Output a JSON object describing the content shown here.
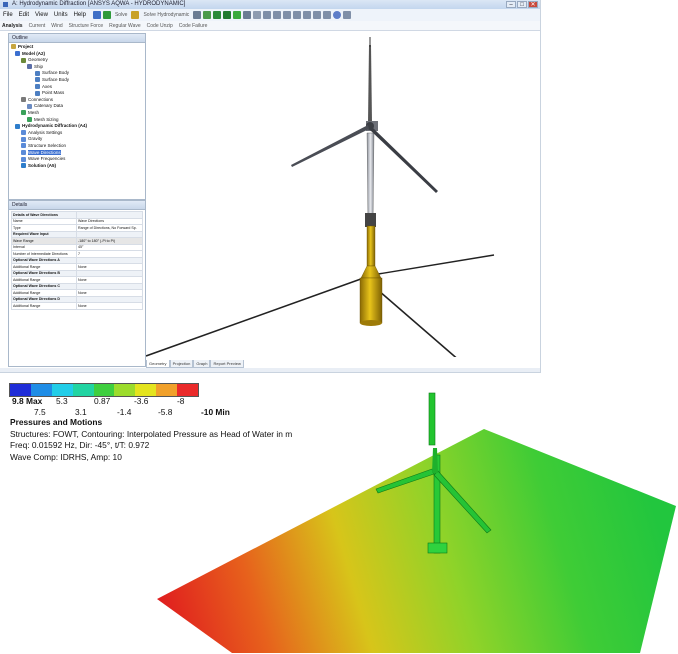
{
  "window": {
    "title": "A: Hydrodynamic Diffraction [ANSYS AQWA - HYDRODYNAMIC]",
    "controls": [
      "–",
      "□",
      "✕"
    ]
  },
  "menu": {
    "items": [
      "File",
      "Edit",
      "View",
      "Units",
      "Help"
    ],
    "toolbar_labels": [
      "Solve",
      "Solve Hydrodynamic"
    ]
  },
  "toolbar2": {
    "analysis": "Analysis",
    "items": [
      "Current",
      "Wind",
      "Structure Force",
      "Regular Wave",
      "Code Unzip",
      "Code Failure"
    ]
  },
  "outline": {
    "title": "Outline",
    "items": [
      {
        "label": "Project",
        "bold": true
      },
      {
        "label": "Model (A2)",
        "bold": true
      },
      {
        "label": "Geometry",
        "bold": false
      },
      {
        "label": "Ship",
        "bold": false
      },
      {
        "label": "Surface Body",
        "bold": false
      },
      {
        "label": "Surface Body",
        "bold": false
      },
      {
        "label": "Axes",
        "bold": false
      },
      {
        "label": "Point Mass",
        "bold": false
      },
      {
        "label": "Connections",
        "bold": false
      },
      {
        "label": "Catenary Data",
        "bold": false
      },
      {
        "label": "Mesh",
        "bold": false
      },
      {
        "label": "Mesh Sizing",
        "bold": false
      },
      {
        "label": "Hydrodynamic Diffraction (A4)",
        "bold": true
      },
      {
        "label": "Analysis Settings",
        "bold": false
      },
      {
        "label": "Gravity",
        "bold": false
      },
      {
        "label": "Structure Selection",
        "bold": false
      },
      {
        "label": "Wave Directions",
        "bold": false,
        "selected": true
      },
      {
        "label": "Wave Frequencies",
        "bold": false
      },
      {
        "label": "Solution (A5)",
        "bold": true
      }
    ]
  },
  "details": {
    "title": "Details",
    "rows": [
      {
        "k": "Details of Wave Directions",
        "v": "",
        "type": "grp"
      },
      {
        "k": "Name",
        "v": "Wave Directions",
        "type": "row"
      },
      {
        "k": "Type",
        "v": "Range of Directions, No Forward Sp.",
        "type": "row"
      },
      {
        "k": "Required Wave Input",
        "v": "",
        "type": "grp"
      },
      {
        "k": "Wave Range",
        "v": "-180° to 180° (-Pi to Pi)",
        "type": "hl"
      },
      {
        "k": "Interval",
        "v": "45°",
        "type": "row"
      },
      {
        "k": "Number of Intermediate Directions",
        "v": "7",
        "type": "row"
      },
      {
        "k": "Optional Wave Directions A",
        "v": "",
        "type": "grp"
      },
      {
        "k": "Additional Range",
        "v": "None",
        "type": "row"
      },
      {
        "k": "Optional Wave Directions B",
        "v": "",
        "type": "grp"
      },
      {
        "k": "Additional Range",
        "v": "None",
        "type": "row"
      },
      {
        "k": "Optional Wave Directions C",
        "v": "",
        "type": "grp"
      },
      {
        "k": "Additional Range",
        "v": "None",
        "type": "row"
      },
      {
        "k": "Optional Wave Directions D",
        "v": "",
        "type": "grp"
      },
      {
        "k": "Additional Range",
        "v": "None",
        "type": "row"
      }
    ]
  },
  "viewport_tabs": [
    "Geometry",
    "Projection",
    "Graph",
    "Report Preview"
  ],
  "legend": {
    "colors": [
      "#1f2dd8",
      "#1f8de6",
      "#22cde8",
      "#22d4a2",
      "#3fcf3f",
      "#9cdc2c",
      "#e4e41e",
      "#f0a02a",
      "#ea2a2a"
    ],
    "top": [
      {
        "text": "9.8 Max",
        "bold": true
      },
      {
        "text": "5.3",
        "bold": false
      },
      {
        "text": "0.87",
        "bold": false
      },
      {
        "text": "-3.6",
        "bold": false
      },
      {
        "text": "-8",
        "bold": false
      }
    ],
    "bottom": [
      {
        "text": "7.5",
        "bold": false
      },
      {
        "text": "3.1",
        "bold": false
      },
      {
        "text": "-1.4",
        "bold": false
      },
      {
        "text": "-5.8",
        "bold": false
      },
      {
        "text": "-10 Min",
        "bold": true
      }
    ]
  },
  "info": {
    "title": "Pressures and Motions",
    "line1": "Structures: FOWT, Contouring: Interpolated Pressure as Head of Water in m",
    "line2": "Freq: 0.01592 Hz, Dir: -45°, t/T: 0.972",
    "line3": "Wave Comp: IDRHS, Amp: 10"
  }
}
